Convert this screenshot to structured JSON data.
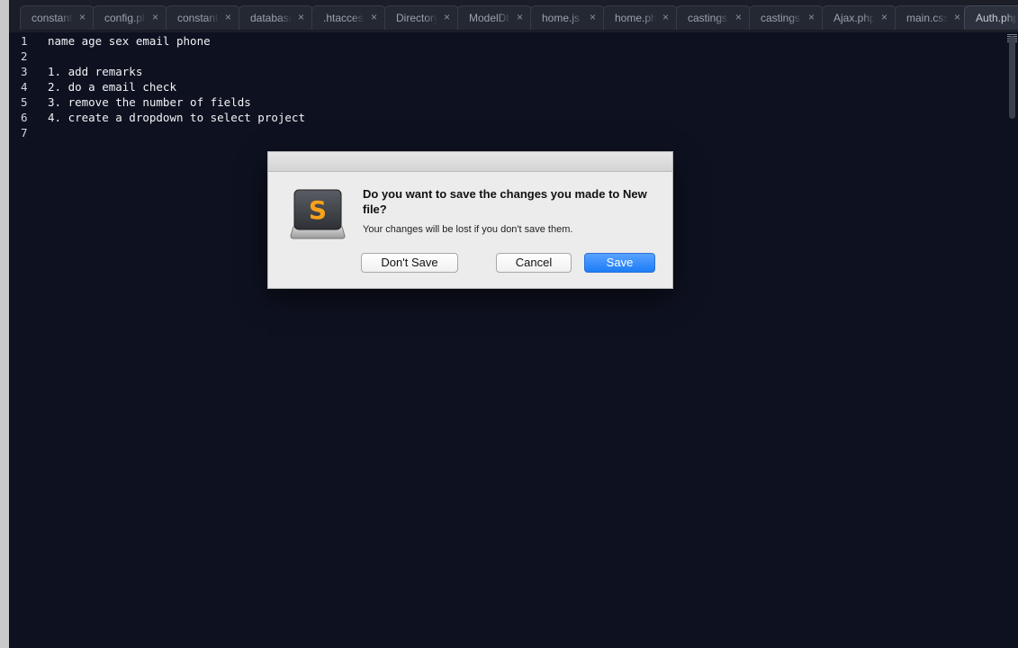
{
  "tabs": [
    {
      "label": "constants.php",
      "active": false
    },
    {
      "label": "config.php",
      "active": false
    },
    {
      "label": "constants.php",
      "active": false
    },
    {
      "label": "database.php",
      "active": false
    },
    {
      "label": ".htaccess",
      "active": false
    },
    {
      "label": "Directory",
      "active": false
    },
    {
      "label": "ModelDb",
      "active": false
    },
    {
      "label": "home.js",
      "active": false
    },
    {
      "label": "home.php",
      "active": false
    },
    {
      "label": "castings",
      "active": false
    },
    {
      "label": "castings",
      "active": false
    },
    {
      "label": "Ajax.php",
      "active": false
    },
    {
      "label": "main.css",
      "active": false
    },
    {
      "label": "Auth.php",
      "active": true
    }
  ],
  "tab_close_glyph": "×",
  "editor": {
    "lines": [
      {
        "num": "1",
        "text": "name age sex email phone"
      },
      {
        "num": "2",
        "text": ""
      },
      {
        "num": "3",
        "text": "1. add remarks"
      },
      {
        "num": "4",
        "text": "2. do a email check"
      },
      {
        "num": "5",
        "text": "3. remove the number of fields"
      },
      {
        "num": "6",
        "text": "4. create a dropdown to select project"
      },
      {
        "num": "7",
        "text": ""
      }
    ]
  },
  "dialog": {
    "title": "Do you want to save the changes you made to New file?",
    "message": "Your changes will be lost if you don't save them.",
    "buttons": {
      "dont_save": "Don't Save",
      "cancel": "Cancel",
      "save": "Save"
    },
    "icon": "sublime-text-app-icon",
    "icon_letter": "S"
  },
  "colors": {
    "editor_bg": "#0e1120",
    "accent": "#1c7cf6",
    "icon_orange": "#f7a21b"
  }
}
